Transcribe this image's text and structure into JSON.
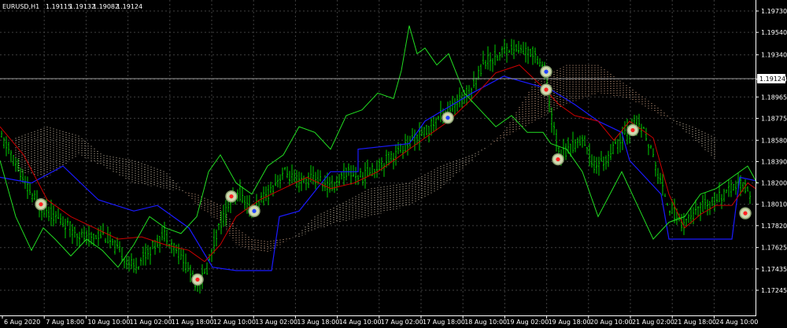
{
  "header": {
    "symbol": "EURUSD,H1",
    "open": "1.19115",
    "high": "1.19132",
    "low": "1.19082",
    "close": "1.19124"
  },
  "colors": {
    "background": "#000000",
    "grid": "#3f3f3f",
    "bars": "#00cc00",
    "chikou": "#22dd22",
    "tenkan": "#cc0000",
    "kijun": "#1a1aff",
    "cloud_bull": "#d8c8b0",
    "cloud_bear": "#e0b090",
    "axis_text": "#ffffff",
    "signal_buy": "#2244ff",
    "signal_sell": "#ff2222"
  },
  "chart_data": {
    "type": "candlestick",
    "title": "",
    "xlabel": "",
    "ylabel": "",
    "ylim": [
      1.1715,
      1.1982
    ],
    "current_price": 1.19124,
    "y_ticks": [
      "1.19730",
      "1.19540",
      "1.19340",
      "1.19124",
      "1.18965",
      "1.18775",
      "1.18580",
      "1.18390",
      "1.18200",
      "1.18010",
      "1.17820",
      "1.17625",
      "1.17435",
      "1.17245"
    ],
    "x_ticks": [
      "6 Aug 2020",
      "7 Aug 18:00",
      "10 Aug 10:00",
      "11 Aug 02:00",
      "11 Aug 18:00",
      "12 Aug 10:00",
      "13 Aug 02:00",
      "13 Aug 18:00",
      "14 Aug 10:00",
      "17 Aug 02:00",
      "17 Aug 18:00",
      "18 Aug 10:00",
      "19 Aug 02:00",
      "19 Aug 18:00",
      "20 Aug 10:00",
      "21 Aug 02:00",
      "21 Aug 18:00",
      "24 Aug 10:00"
    ],
    "close_path": [
      [
        0,
        1.1862
      ],
      [
        15,
        1.1845
      ],
      [
        30,
        1.182
      ],
      [
        50,
        1.18
      ],
      [
        70,
        1.179
      ],
      [
        90,
        1.178
      ],
      [
        110,
        1.177
      ],
      [
        130,
        1.1775
      ],
      [
        150,
        1.176
      ],
      [
        170,
        1.1745
      ],
      [
        190,
        1.176
      ],
      [
        210,
        1.1775
      ],
      [
        230,
        1.1755
      ],
      [
        250,
        1.173
      ],
      [
        262,
        1.174
      ],
      [
        275,
        1.1775
      ],
      [
        290,
        1.18
      ],
      [
        305,
        1.181
      ],
      [
        320,
        1.1795
      ],
      [
        340,
        1.181
      ],
      [
        360,
        1.183
      ],
      [
        380,
        1.182
      ],
      [
        400,
        1.1825
      ],
      [
        420,
        1.1815
      ],
      [
        440,
        1.183
      ],
      [
        460,
        1.1825
      ],
      [
        480,
        1.1835
      ],
      [
        500,
        1.1845
      ],
      [
        520,
        1.1855
      ],
      [
        540,
        1.1865
      ],
      [
        560,
        1.188
      ],
      [
        580,
        1.189
      ],
      [
        600,
        1.1905
      ],
      [
        615,
        1.1928
      ],
      [
        630,
        1.1932
      ],
      [
        645,
        1.194
      ],
      [
        660,
        1.1938
      ],
      [
        680,
        1.1935
      ],
      [
        693,
        1.192
      ],
      [
        700,
        1.188
      ],
      [
        712,
        1.1845
      ],
      [
        725,
        1.185
      ],
      [
        740,
        1.186
      ],
      [
        755,
        1.1835
      ],
      [
        770,
        1.184
      ],
      [
        790,
        1.186
      ],
      [
        805,
        1.1872
      ],
      [
        820,
        1.1865
      ],
      [
        835,
        1.183
      ],
      [
        850,
        1.18
      ],
      [
        865,
        1.1785
      ],
      [
        880,
        1.179
      ],
      [
        895,
        1.18
      ],
      [
        910,
        1.1805
      ],
      [
        925,
        1.1812
      ],
      [
        940,
        1.182
      ],
      [
        955,
        1.181
      ]
    ],
    "tenkan": [
      [
        0,
        1.187
      ],
      [
        30,
        1.1845
      ],
      [
        60,
        1.1805
      ],
      [
        90,
        1.179
      ],
      [
        120,
        1.178
      ],
      [
        150,
        1.177
      ],
      [
        180,
        1.1772
      ],
      [
        210,
        1.1765
      ],
      [
        240,
        1.176
      ],
      [
        260,
        1.175
      ],
      [
        280,
        1.1765
      ],
      [
        300,
        1.179
      ],
      [
        330,
        1.1805
      ],
      [
        360,
        1.1815
      ],
      [
        390,
        1.1825
      ],
      [
        420,
        1.1815
      ],
      [
        450,
        1.182
      ],
      [
        480,
        1.183
      ],
      [
        510,
        1.1845
      ],
      [
        540,
        1.186
      ],
      [
        570,
        1.1875
      ],
      [
        600,
        1.1895
      ],
      [
        630,
        1.1918
      ],
      [
        660,
        1.1925
      ],
      [
        690,
        1.1905
      ],
      [
        710,
        1.189
      ],
      [
        730,
        1.188
      ],
      [
        760,
        1.1875
      ],
      [
        780,
        1.1858
      ],
      [
        800,
        1.1875
      ],
      [
        830,
        1.186
      ],
      [
        850,
        1.181
      ],
      [
        870,
        1.178
      ],
      [
        890,
        1.1792
      ],
      [
        910,
        1.18
      ],
      [
        930,
        1.18
      ],
      [
        950,
        1.182
      ],
      [
        960,
        1.1815
      ]
    ],
    "kijun": [
      [
        0,
        1.1825
      ],
      [
        40,
        1.182
      ],
      [
        80,
        1.1835
      ],
      [
        125,
        1.1805
      ],
      [
        170,
        1.1795
      ],
      [
        200,
        1.18
      ],
      [
        240,
        1.178
      ],
      [
        270,
        1.1745
      ],
      [
        300,
        1.1742
      ],
      [
        345,
        1.1742
      ],
      [
        355,
        1.179
      ],
      [
        380,
        1.1795
      ],
      [
        420,
        1.183
      ],
      [
        455,
        1.183
      ],
      [
        455,
        1.185
      ],
      [
        520,
        1.1855
      ],
      [
        540,
        1.1875
      ],
      [
        600,
        1.19
      ],
      [
        640,
        1.1915
      ],
      [
        700,
        1.1903
      ],
      [
        730,
        1.189
      ],
      [
        760,
        1.1875
      ],
      [
        790,
        1.1865
      ],
      [
        800,
        1.184
      ],
      [
        840,
        1.181
      ],
      [
        850,
        1.177
      ],
      [
        930,
        1.177
      ],
      [
        940,
        1.1825
      ],
      [
        960,
        1.1822
      ]
    ],
    "chikou": [
      [
        0,
        1.184
      ],
      [
        20,
        1.179
      ],
      [
        40,
        1.176
      ],
      [
        55,
        1.178
      ],
      [
        70,
        1.177
      ],
      [
        90,
        1.1755
      ],
      [
        110,
        1.177
      ],
      [
        130,
        1.176
      ],
      [
        150,
        1.1745
      ],
      [
        170,
        1.1765
      ],
      [
        190,
        1.179
      ],
      [
        210,
        1.178
      ],
      [
        230,
        1.1775
      ],
      [
        250,
        1.179
      ],
      [
        265,
        1.183
      ],
      [
        280,
        1.1845
      ],
      [
        300,
        1.182
      ],
      [
        320,
        1.181
      ],
      [
        340,
        1.1835
      ],
      [
        360,
        1.1845
      ],
      [
        380,
        1.187
      ],
      [
        400,
        1.1865
      ],
      [
        420,
        1.185
      ],
      [
        440,
        1.188
      ],
      [
        460,
        1.1885
      ],
      [
        480,
        1.19
      ],
      [
        500,
        1.1895
      ],
      [
        510,
        1.192
      ],
      [
        520,
        1.196
      ],
      [
        530,
        1.1935
      ],
      [
        540,
        1.194
      ],
      [
        555,
        1.1925
      ],
      [
        570,
        1.1935
      ],
      [
        590,
        1.19
      ],
      [
        610,
        1.1885
      ],
      [
        630,
        1.187
      ],
      [
        650,
        1.188
      ],
      [
        670,
        1.1865
      ],
      [
        690,
        1.1865
      ],
      [
        700,
        1.1855
      ],
      [
        720,
        1.185
      ],
      [
        740,
        1.183
      ],
      [
        760,
        1.179
      ],
      [
        775,
        1.181
      ],
      [
        790,
        1.183
      ],
      [
        810,
        1.18
      ],
      [
        830,
        1.177
      ],
      [
        850,
        1.1785
      ],
      [
        870,
        1.179
      ],
      [
        890,
        1.181
      ],
      [
        910,
        1.1815
      ],
      [
        930,
        1.1825
      ],
      [
        950,
        1.1835
      ],
      [
        962,
        1.182
      ]
    ],
    "span_a": [
      [
        20,
        1.186
      ],
      [
        60,
        1.187
      ],
      [
        100,
        1.1862
      ],
      [
        130,
        1.1845
      ],
      [
        170,
        1.184
      ],
      [
        210,
        1.183
      ],
      [
        250,
        1.18
      ],
      [
        280,
        1.1785
      ],
      [
        300,
        1.1765
      ],
      [
        320,
        1.176
      ],
      [
        340,
        1.1758
      ],
      [
        380,
        1.1775
      ],
      [
        400,
        1.179
      ],
      [
        430,
        1.18
      ],
      [
        470,
        1.1815
      ],
      [
        520,
        1.182
      ],
      [
        560,
        1.1835
      ],
      [
        600,
        1.1845
      ],
      [
        640,
        1.186
      ],
      [
        680,
        1.1875
      ],
      [
        720,
        1.189
      ],
      [
        760,
        1.19
      ],
      [
        800,
        1.1895
      ],
      [
        840,
        1.188
      ],
      [
        880,
        1.187
      ],
      [
        910,
        1.186
      ]
    ],
    "span_b": [
      [
        20,
        1.183
      ],
      [
        60,
        1.1825
      ],
      [
        100,
        1.1845
      ],
      [
        130,
        1.1835
      ],
      [
        170,
        1.182
      ],
      [
        210,
        1.1815
      ],
      [
        250,
        1.181
      ],
      [
        280,
        1.18
      ],
      [
        300,
        1.178
      ],
      [
        320,
        1.177
      ],
      [
        340,
        1.1768
      ],
      [
        380,
        1.1772
      ],
      [
        400,
        1.1778
      ],
      [
        430,
        1.1785
      ],
      [
        470,
        1.179
      ],
      [
        520,
        1.18
      ],
      [
        560,
        1.1815
      ],
      [
        600,
        1.184
      ],
      [
        640,
        1.1865
      ],
      [
        680,
        1.191
      ],
      [
        720,
        1.1925
      ],
      [
        760,
        1.1925
      ],
      [
        800,
        1.1905
      ],
      [
        840,
        1.1885
      ],
      [
        880,
        1.186
      ],
      [
        910,
        1.184
      ]
    ],
    "signals": [
      [
        52,
        1.1801,
        "sell"
      ],
      [
        251,
        1.1734,
        "sell"
      ],
      [
        294,
        1.1808,
        "sell"
      ],
      [
        323,
        1.1795,
        "buy"
      ],
      [
        569,
        1.1878,
        "buy"
      ],
      [
        694,
        1.1919,
        "buy"
      ],
      [
        694,
        1.1903,
        "sell"
      ],
      [
        709,
        1.1841,
        "sell"
      ],
      [
        804,
        1.1867,
        "sell"
      ],
      [
        947,
        1.1793,
        "sell"
      ]
    ]
  }
}
